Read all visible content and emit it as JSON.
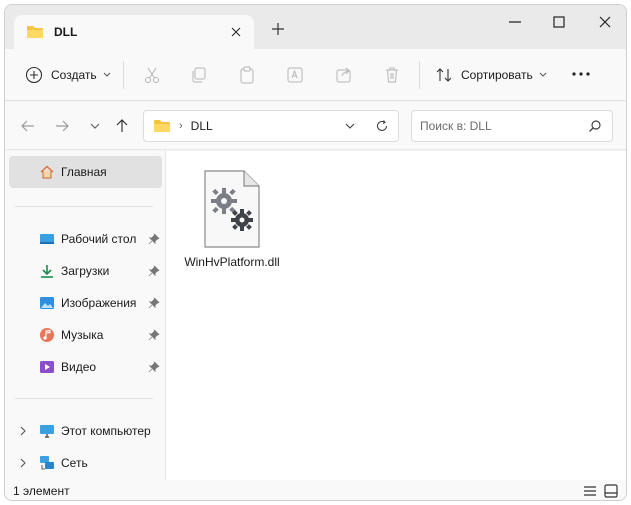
{
  "window": {
    "tab_title": "DLL"
  },
  "commandbar": {
    "create_label": "Создать",
    "sort_label": "Сортировать"
  },
  "address": {
    "path": "DLL",
    "separator": "›"
  },
  "search": {
    "placeholder": "Поиск в: DLL"
  },
  "sidebar": {
    "home": "Главная",
    "quick_access": [
      {
        "label": "Рабочий стол",
        "icon": "desktop-icon"
      },
      {
        "label": "Загрузки",
        "icon": "downloads-icon"
      },
      {
        "label": "Изображения",
        "icon": "pictures-icon"
      },
      {
        "label": "Музыка",
        "icon": "music-icon"
      },
      {
        "label": "Видео",
        "icon": "videos-icon"
      }
    ],
    "this_pc": "Этот компьютер",
    "network": "Сеть"
  },
  "content": {
    "files": [
      {
        "name": "WinHvPlatform.dll",
        "icon": "dll-file-icon"
      }
    ]
  },
  "statusbar": {
    "item_count": "1 элемент"
  },
  "colors": {
    "folder": "#f5c542",
    "accent": "#0067c0",
    "selected": "#e1e1e1"
  }
}
